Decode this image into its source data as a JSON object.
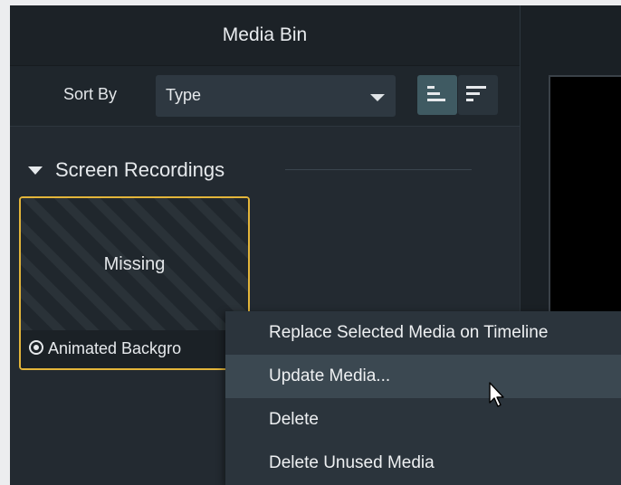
{
  "media_bin": {
    "title": "Media Bin",
    "sort_by_label": "Sort By",
    "sort_value": "Type",
    "view_toggle": {
      "ascending_icon": "sort-ascending-icon",
      "descending_icon": "sort-descending-icon"
    },
    "section": {
      "title": "Screen Recordings",
      "icon": "triangle-down-icon"
    },
    "thumbnail": {
      "status_label": "Missing",
      "name": "Animated Backgro",
      "icon": "radio-selected-icon"
    }
  },
  "context_menu": {
    "items": [
      "Replace Selected Media on Timeline",
      "Update Media...",
      "Delete",
      "Delete Unused Media"
    ],
    "hovered_item": "Update Media..."
  },
  "colors": {
    "selection_border": "#e3b53a",
    "panel_bg": "#232a31",
    "menu_bg": "#2b343c",
    "menu_hover": "#3b4851",
    "toggle_active": "#3f5a62"
  }
}
